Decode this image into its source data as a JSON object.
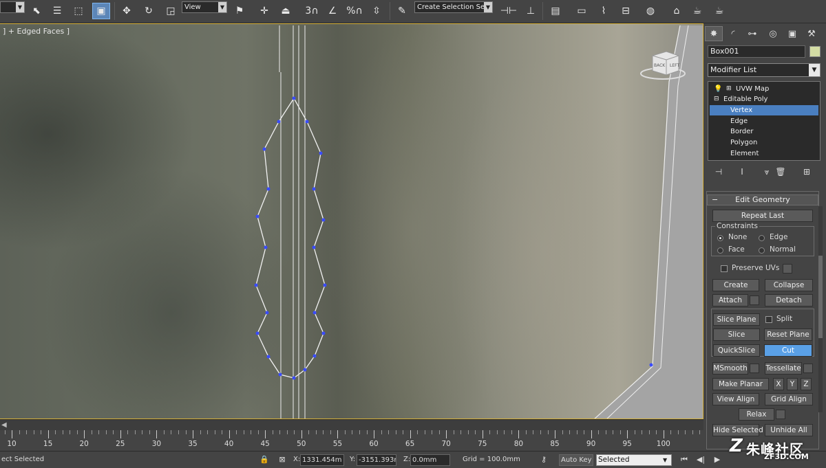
{
  "toolbar": {
    "view_dropdown": "View",
    "selection_set_placeholder": "Create Selection Se",
    "snap_3": "3",
    "snap_percent": "%"
  },
  "viewport": {
    "label": "] + Edged Faces ]",
    "viewcube_front": "BACK",
    "viewcube_side": "LEFT"
  },
  "command_panel": {
    "object_name": "Box001",
    "object_color": "#d4dda4",
    "modifier_list": "Modifier List",
    "stack": [
      {
        "label": "UVW Map"
      },
      {
        "label": "Editable Poly"
      },
      {
        "label": "Vertex"
      },
      {
        "label": "Edge"
      },
      {
        "label": "Border"
      },
      {
        "label": "Polygon"
      },
      {
        "label": "Element"
      }
    ],
    "rollout_title": "Edit Geometry",
    "repeat_last": "Repeat Last",
    "constraints": {
      "title": "Constraints",
      "none": "None",
      "edge": "Edge",
      "face": "Face",
      "normal": "Normal"
    },
    "preserve_uvs": "Preserve UVs",
    "create": "Create",
    "collapse": "Collapse",
    "attach": "Attach",
    "detach": "Detach",
    "slice_plane": "Slice Plane",
    "split": "Split",
    "slice": "Slice",
    "reset_plane": "Reset Plane",
    "quickslice": "QuickSlice",
    "cut": "Cut",
    "msmooth": "MSmooth",
    "tessellate": "Tessellate",
    "make_planar": "Make Planar",
    "x": "X",
    "y": "Y",
    "z": "Z",
    "view_align": "View Align",
    "grid_align": "Grid Align",
    "relax": "Relax",
    "hide_selected": "Hide Selected",
    "unhide_all": "Unhide All"
  },
  "timeline": {
    "ticks": [
      "10",
      "15",
      "20",
      "25",
      "30",
      "35",
      "40",
      "45",
      "50",
      "55",
      "60",
      "65",
      "70",
      "75",
      "80",
      "85",
      "90",
      "95",
      "100"
    ]
  },
  "status": {
    "selection_msg": "ect Selected",
    "x_label": "X:",
    "x_value": "1331.454m",
    "y_label": "Y:",
    "y_value": "-3151.393r",
    "z_label": "Z:",
    "z_value": "0.0mm",
    "grid": "Grid = 100.0mm",
    "auto_key": "Auto Key",
    "selected": "Selected"
  },
  "watermark": {
    "main": "朱峰社区",
    "sub": "ZF3D.COM"
  },
  "colors": {
    "selection_blue": "#4a7fc0",
    "active_button": "#5aa0e6",
    "vertex_blue": "#3a4cff",
    "viewport_border": "#d8b23a"
  }
}
